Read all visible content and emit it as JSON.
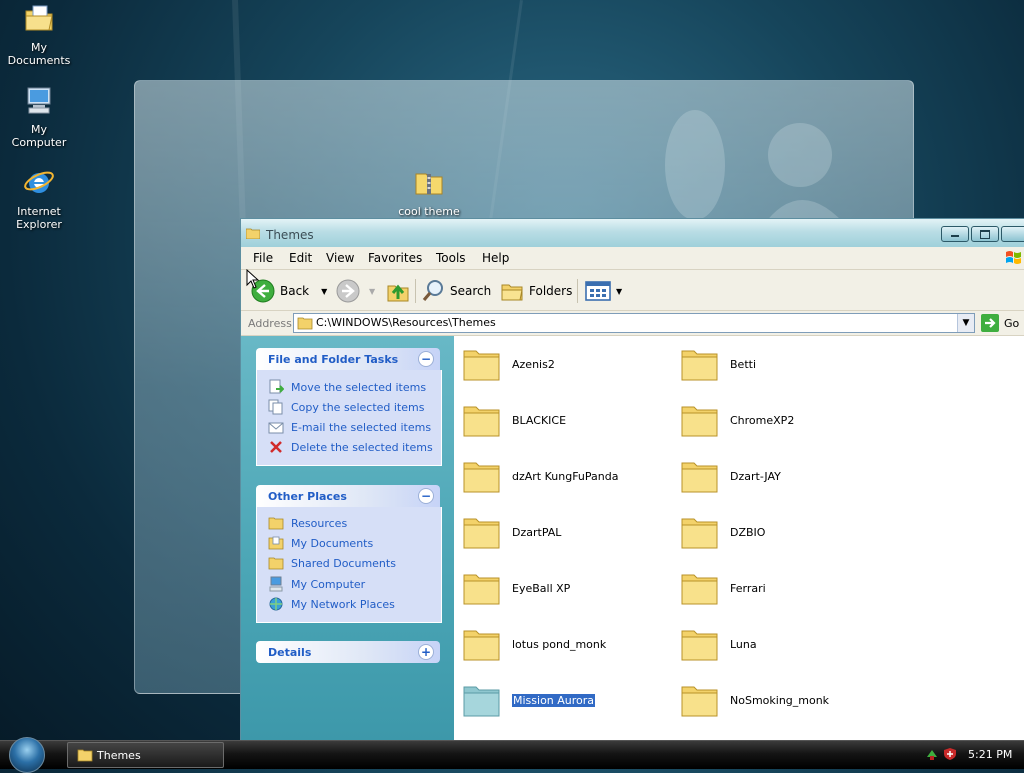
{
  "desktop": {
    "icons": [
      {
        "label_line1": "My",
        "label_line2": "Documents"
      },
      {
        "label_line1": "My",
        "label_line2": "Computer"
      },
      {
        "label_line1": "Internet",
        "label_line2": "Explorer"
      }
    ],
    "zip_icon_label": "cool theme"
  },
  "window": {
    "title": "Themes",
    "menu": [
      "File",
      "Edit",
      "View",
      "Favorites",
      "Tools",
      "Help"
    ],
    "toolbar": {
      "back": "Back",
      "search": "Search",
      "folders": "Folders"
    },
    "address": {
      "label": "Address",
      "value": "C:\\WINDOWS\\Resources\\Themes",
      "go": "Go"
    },
    "task_panes": {
      "file_tasks": {
        "title": "File and Folder Tasks",
        "items": [
          "Move the selected items",
          "Copy the selected items",
          "E-mail the selected items",
          "Delete the selected items"
        ]
      },
      "other_places": {
        "title": "Other Places",
        "items": [
          "Resources",
          "My Documents",
          "Shared Documents",
          "My Computer",
          "My Network Places"
        ]
      },
      "details": {
        "title": "Details"
      }
    },
    "folders": [
      "Azenis2",
      "Betti",
      "BLACKICE",
      "ChromeXP2",
      "dzArt KungFuPanda",
      "Dzart-JAY",
      "DzartPAL",
      "DZBIO",
      "EyeBall XP",
      "Ferrari",
      "lotus pond_monk",
      "Luna",
      "Mission Aurora",
      "NoSmoking_monk"
    ],
    "selected_folder": "Mission Aurora"
  },
  "taskbar": {
    "task_label": "Themes",
    "clock": "5:21 PM"
  }
}
